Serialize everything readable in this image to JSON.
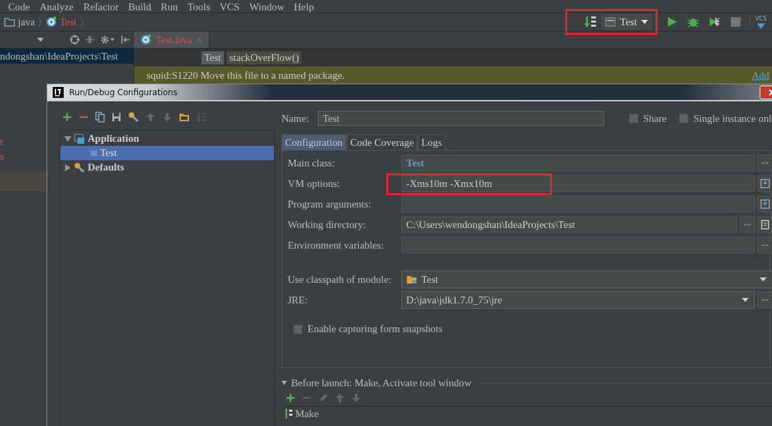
{
  "menu": [
    {
      "label": "Code"
    },
    {
      "label": "Analyze"
    },
    {
      "label": "Refactor"
    },
    {
      "label": "Build"
    },
    {
      "label": "Run"
    },
    {
      "label": "Tools"
    },
    {
      "label": "VCS"
    },
    {
      "label": "Window"
    },
    {
      "label": "Help"
    }
  ],
  "breadcrumb": [
    {
      "label": "java",
      "kind": "folder"
    },
    {
      "label": "Test",
      "kind": "class"
    }
  ],
  "run_toolbar": {
    "config": "Test",
    "highlighted": true,
    "vcs": "VCS"
  },
  "project_panel": {
    "items": [
      {
        "label": "ndongshan\\IdeaProjects\\Test",
        "selected": true
      },
      {
        "label": "t",
        "selected": false
      },
      {
        "label": "s",
        "selected": false
      }
    ]
  },
  "editor": {
    "tab": "Test.java",
    "crumbs": [
      "Test",
      "stackOverFlow()"
    ],
    "banner": {
      "text": "squid:S1220 Move this file to a named package.",
      "link": "Add"
    }
  },
  "dialog": {
    "title": "Run/Debug Configurations",
    "tree": [
      {
        "label": "Application",
        "expanded": true,
        "children": [
          {
            "label": "Test",
            "selected": true
          }
        ]
      },
      {
        "label": "Defaults",
        "expanded": false
      }
    ],
    "name_label": "Name:",
    "name": "Test",
    "share": {
      "label": "Share",
      "checked": false
    },
    "single": {
      "label": "Single instance onl",
      "checked": false
    },
    "tabs": [
      {
        "label": "Configuration",
        "selected": true
      },
      {
        "label": "Code Coverage",
        "selected": false
      },
      {
        "label": "Logs",
        "selected": false
      }
    ],
    "fields": [
      {
        "label": "Main class:",
        "value": "Test",
        "kind": "class"
      },
      {
        "label": "VM options:",
        "value": "-Xms10m -Xmx10m",
        "kind": "expand",
        "highlighted": true
      },
      {
        "label": "Program arguments:",
        "kind": "expand"
      },
      {
        "label": "Working directory:",
        "value": "C:\\Users\\wendongshan\\IdeaProjects\\Test",
        "kind": "dir"
      },
      {
        "label": "Environment variables:",
        "kind": "browse"
      }
    ],
    "module": {
      "label": "Use classpath of module:",
      "value": "Test"
    },
    "jre": {
      "label": "JRE:",
      "value": "D:\\java\\jdk1.7.0_75\\jre"
    },
    "snapshots": {
      "label": "Enable capturing form snapshots",
      "checked": false
    },
    "before_launch": {
      "title": "Before launch: Make, Activate tool window",
      "expanded": true,
      "items": [
        "Make"
      ]
    }
  }
}
